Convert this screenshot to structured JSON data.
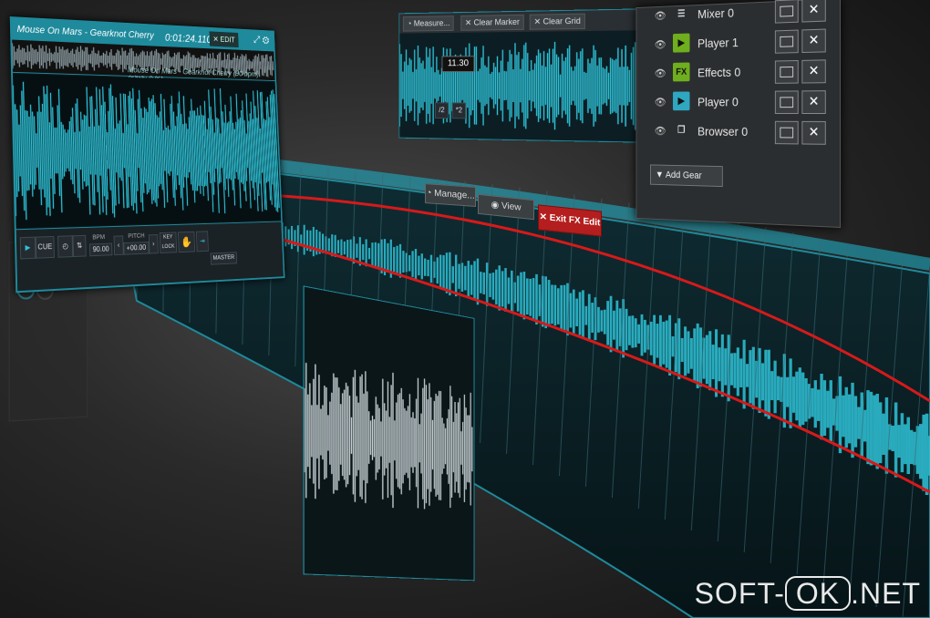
{
  "player": {
    "track_title": "Mouse On Mars - Gearknot Cherry",
    "time": "0:01:24.110",
    "edit_label": "EDIT",
    "subtitle": "Mouse On Mars - Gearknot Cherry (90 bpm) (pitch: 0 %)",
    "cue_label": "CUE",
    "bpm_label": "BPM",
    "bpm_value": "90.00",
    "pitch_label": "PITCH",
    "pitch_value": "+00.00",
    "keylock_label": "KEY LOCK",
    "master_label": "MASTER"
  },
  "grid_panel": {
    "measure_label": "Measure...",
    "clear_marker_label": "Clear Marker",
    "clear_grid_label": "Clear Grid",
    "value": "11.30",
    "div2_label": "/2",
    "mul2_label": "*2"
  },
  "gear": {
    "rows": [
      {
        "label": "Mixer 0",
        "icon": "mixer-icon"
      },
      {
        "label": "Player 1",
        "icon": "play-icon"
      },
      {
        "label": "Effects 0",
        "icon": "fx-icon"
      },
      {
        "label": "Player 0",
        "icon": "play-icon"
      },
      {
        "label": "Browser 0",
        "icon": "browser-icon"
      }
    ],
    "add_gear_label": "Add Gear"
  },
  "fx_bar": {
    "manage_label": "Manage...",
    "view_label": "View",
    "exit_label": "Exit FX Edit"
  },
  "watermark": {
    "left": "SOFT-",
    "middle": "OK",
    "right": ".NET"
  },
  "colors": {
    "accent": "#1e8a9c",
    "waveform": "#2fc3d8",
    "automation": "#d61a1a",
    "exit_button": "#b41e1e"
  }
}
